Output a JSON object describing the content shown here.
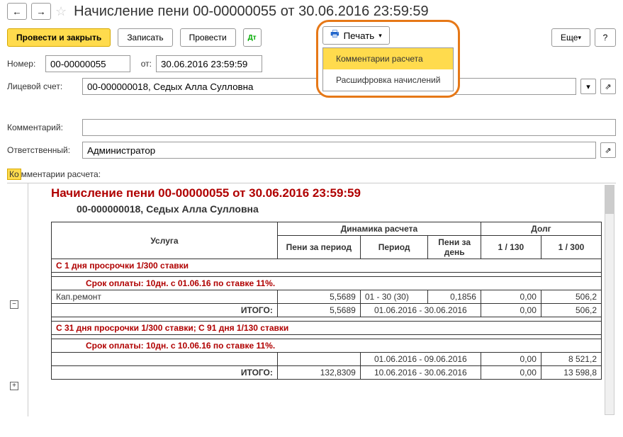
{
  "header": {
    "title": "Начисление пени 00-00000055 от 30.06.2016 23:59:59"
  },
  "toolbar": {
    "post_close": "Провести и закрыть",
    "save": "Записать",
    "post": "Провести",
    "print": "Печать",
    "print_menu": {
      "comments": "Комментарии расчета",
      "details": "Расшифровка начислений"
    },
    "more": "Еще",
    "help": "?"
  },
  "form": {
    "number_label": "Номер:",
    "number": "00-00000055",
    "from_label": "от:",
    "date": "30.06.2016 23:59:59",
    "account_label": "Лицевой счет:",
    "account": "00-000000018, Седых Алла Сулловна",
    "comment_label": "Комментарий:",
    "comment": "",
    "responsible_label": "Ответственный:",
    "responsible": "Администратор"
  },
  "section": {
    "label_pre": "Ко",
    "label_post": "мментарии расчета:"
  },
  "report": {
    "title": "Начисление пени 00-00000055 от 30.06.2016 23:59:59",
    "subtitle": "00-000000018, Седых Алла Сулловна",
    "headers": {
      "service": "Услуга",
      "dynamics": "Динамика расчета",
      "debt": "Долг",
      "peni_period": "Пени за период",
      "period": "Период",
      "peni_day": "Пени за день",
      "r130": "1 / 130",
      "r300": "1 / 300"
    },
    "group1": {
      "head": "С 1 дня просрочки 1/300 ставки",
      "term": "Срок оплаты: 10дн. с 01.06.16 по ставке 11%.",
      "row_label": "Кап.ремонт",
      "r_peni": "5,5689",
      "r_period": "01 - 30 (30)",
      "r_day": "0,1856",
      "r_130": "0,00",
      "r_300": "506,2",
      "total_label": "ИТОГО:",
      "t_peni": "5,5689",
      "t_period": "01.06.2016 - 30.06.2016",
      "t_130": "0,00",
      "t_300": "506,2"
    },
    "group2": {
      "head": "С 31 дня просрочки 1/300 ставки; С 91 дня 1/130 ставки",
      "term": "Срок оплаты: 10дн. с 10.06.16 по ставке 11%.",
      "p1_period": "01.06.2016 - 09.06.2016",
      "p1_130": "0,00",
      "p1_300": "8 521,2",
      "total_label": "ИТОГО:",
      "t_peni": "132,8309",
      "t_period": "10.06.2016 - 30.06.2016",
      "t_130": "0,00",
      "t_300": "13 598,8"
    }
  }
}
